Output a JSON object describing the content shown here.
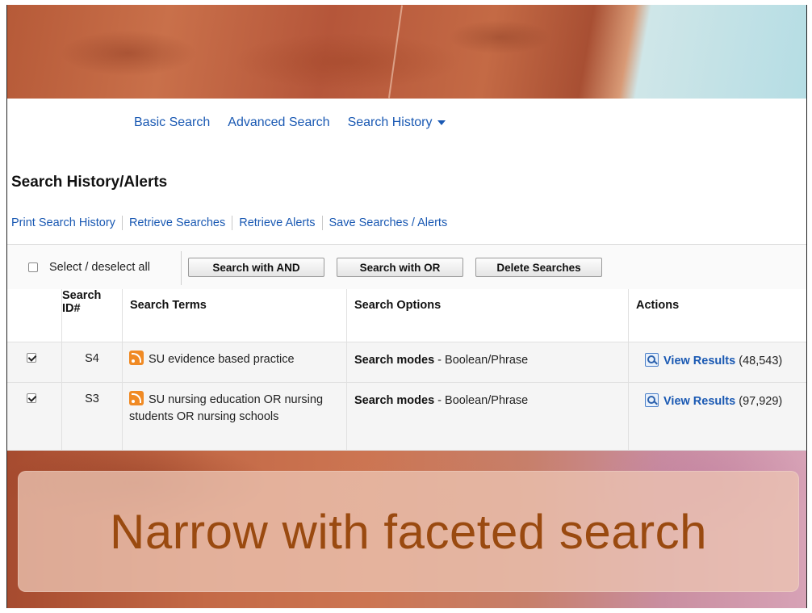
{
  "nav": {
    "basic_search": "Basic Search",
    "advanced_search": "Advanced Search",
    "search_history": "Search History"
  },
  "page_title": "Search History/Alerts",
  "links": {
    "print": "Print Search History",
    "retrieve_searches": "Retrieve Searches",
    "retrieve_alerts": "Retrieve Alerts",
    "save": "Save Searches / Alerts"
  },
  "toolbar": {
    "select_all_label": "Select / deselect all",
    "select_all_checked": false,
    "search_and": "Search with AND",
    "search_or": "Search with OR",
    "delete": "Delete Searches"
  },
  "table": {
    "headers": {
      "id_line1": "Search",
      "id_line2": "ID#",
      "terms": "Search Terms",
      "options": "Search Options",
      "actions": "Actions"
    },
    "rows": [
      {
        "checked": true,
        "id": "S4",
        "terms": "SU evidence based practice",
        "options_label": "Search modes",
        "options_value": " - Boolean/Phrase",
        "action_label": "View Results",
        "count": "(48,543)"
      },
      {
        "checked": true,
        "id": "S3",
        "terms": "SU nursing education OR nursing students OR nursing schools",
        "options_label": "Search modes",
        "options_value": " - Boolean/Phrase",
        "action_label": "View Results",
        "count": "(97,929)"
      }
    ]
  },
  "banner": {
    "text": "Narrow with faceted search"
  },
  "colors": {
    "link": "#1a59b3",
    "banner_text": "#9a4a10",
    "rss": "#f08a24"
  },
  "icons": {
    "nav_caret": "chevron-down-icon",
    "feed": "rss-icon",
    "view": "magnifier-icon"
  }
}
